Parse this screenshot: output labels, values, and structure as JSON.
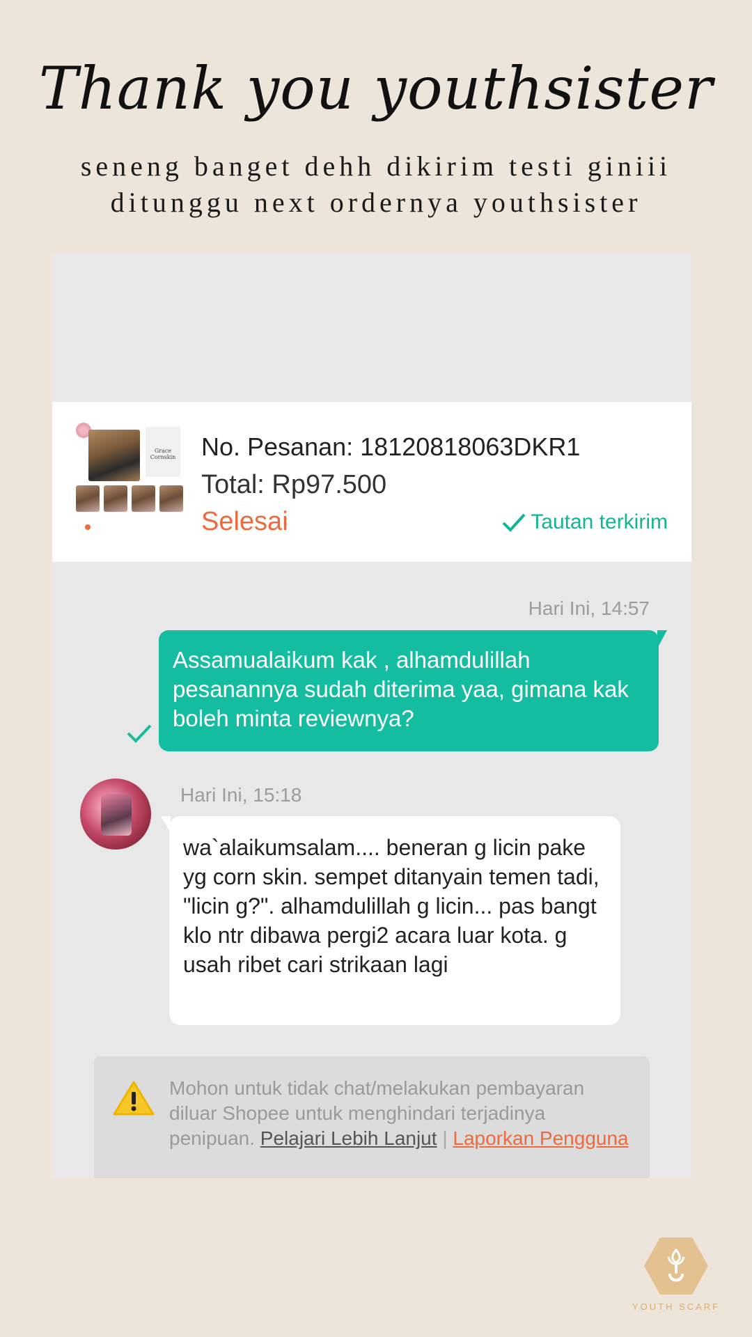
{
  "header": {
    "title": "Thank you youthsister",
    "subtitle_line1": "seneng banget dehh dikirim testi giniii",
    "subtitle_line2": "ditunggu next ordernya youthsister"
  },
  "order": {
    "number_text": "No. Pesanan: 18120818063DKR1",
    "total_text": "Total: Rp97.500",
    "status": "Selesai",
    "link_status": "Tautan terkirim",
    "thumbnail_label": "Grace Cornskin"
  },
  "chat": {
    "outgoing": {
      "time": "Hari Ini, 14:57",
      "text": "Assamualaikum kak , alhamdulillah pesanannya sudah diterima yaa, gimana kak boleh minta reviewnya?"
    },
    "incoming": {
      "time": "Hari Ini, 15:18",
      "text": "wa`alaikumsalam.... beneran g licin pake yg corn skin. sempet ditanyain temen tadi, \"licin g?\". alhamdulillah g licin... pas bangt klo ntr dibawa pergi2 acara luar kota. g usah ribet cari strikaan lagi"
    }
  },
  "notice": {
    "text": "Mohon untuk tidak chat/melakukan pembayaran diluar Shopee untuk menghindari terjadinya penipuan.",
    "learn_more": "Pelajari Lebih Lanjut",
    "separator": "|",
    "report": "Laporkan Pengguna"
  },
  "brand": {
    "name": "YOUTH SCARF"
  },
  "colors": {
    "background": "#ede4da",
    "accent_green": "#14bca0",
    "accent_orange": "#ee6a3c",
    "logo_gold": "#d7b07a"
  },
  "icons": [
    "check-icon",
    "warning-icon",
    "brand-logo-icon"
  ]
}
